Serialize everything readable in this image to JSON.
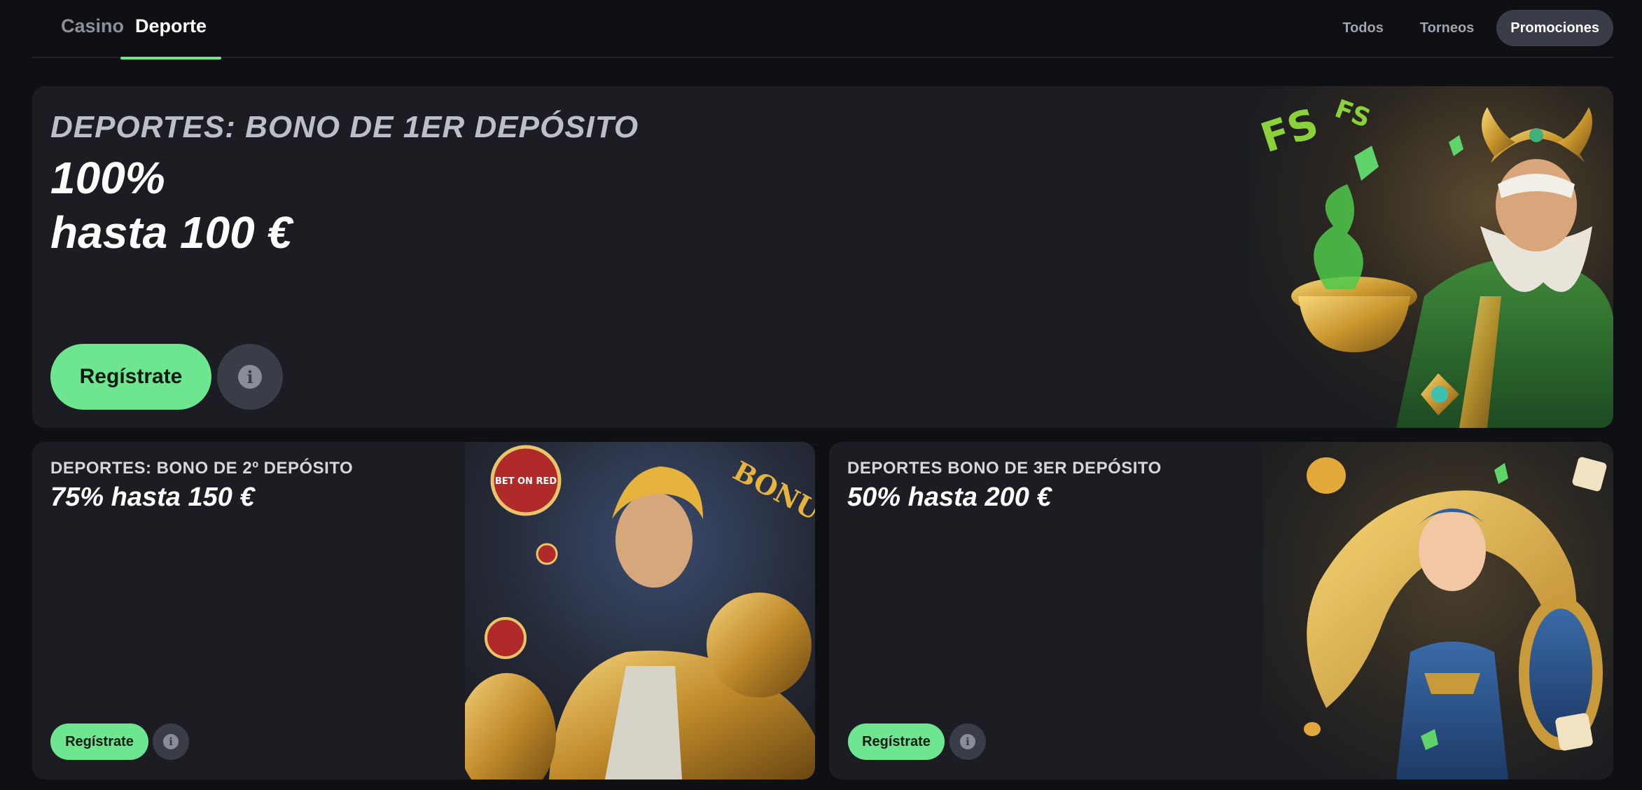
{
  "nav": {
    "main_tabs": [
      {
        "label": "Casino",
        "active": false
      },
      {
        "label": "Deporte",
        "active": true
      }
    ],
    "filters": [
      {
        "label": "Todos",
        "active": false
      },
      {
        "label": "Torneos",
        "active": false
      },
      {
        "label": "Promociones",
        "active": true
      }
    ]
  },
  "hero": {
    "title": "DEPORTES: BONO DE 1ER DEPÓSITO",
    "amount_line1": "100%",
    "amount_line2": "hasta 100 €",
    "register_label": "Regístrate",
    "info_glyph": "i"
  },
  "cards": [
    {
      "title": "DEPORTES: BONO DE 2º DEPÓSITO",
      "amount": "75% hasta 150 €",
      "register_label": "Regístrate",
      "info_glyph": "i"
    },
    {
      "title": "DEPORTES BONO DE 3ER DEPÓSITO",
      "amount": "50% hasta 200 €",
      "register_label": "Regístrate",
      "info_glyph": "i"
    }
  ],
  "art_text": {
    "fs_badge_1": "FS",
    "fs_badge_2": "FS",
    "bonus_sign": "BONUS",
    "chip_text": "BET ON RED"
  },
  "colors": {
    "accent_green": "#6ee58f",
    "card_bg": "#1c1d22",
    "page_bg": "#0f1014",
    "active_filter_bg": "#3a3d47"
  }
}
